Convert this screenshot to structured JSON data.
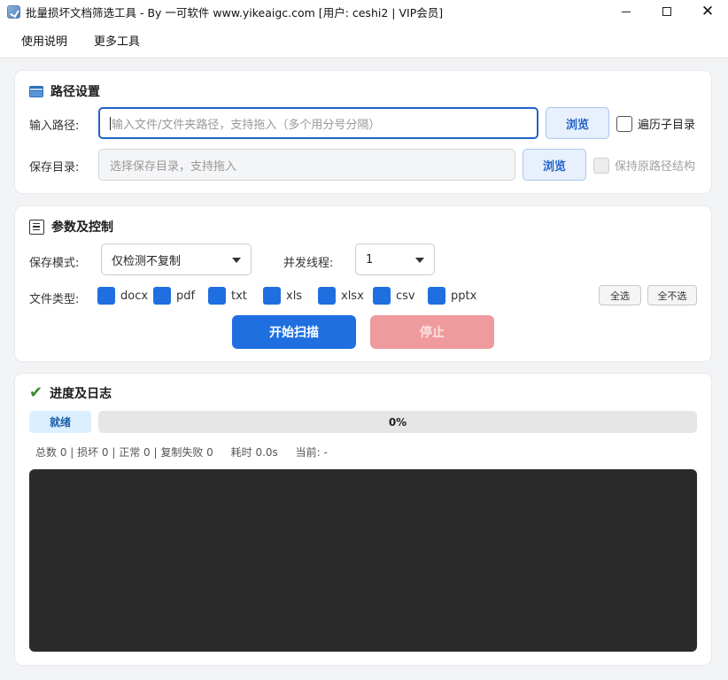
{
  "window": {
    "title": "批量损坏文档筛选工具 - By 一可软件 www.yikeaigc.com  [用户: ceshi2 | VIP会员]",
    "minimize_icon": "minimize-icon",
    "maximize_icon": "maximize-icon",
    "close_glyph": "✕"
  },
  "menu": {
    "items": [
      "使用说明",
      "更多工具"
    ]
  },
  "path_section": {
    "title": "路径设置",
    "icon": "folder-icon",
    "input_label": "输入路径:",
    "input_placeholder": "输入文件/文件夹路径，支持拖入（多个用分号分隔）",
    "input_value": "",
    "browse_label": "浏览",
    "recurse_label": "遍历子目录",
    "recurse_checked": false,
    "save_label": "保存目录:",
    "save_placeholder": "选择保存目录，支持拖入",
    "save_value": "",
    "save_browse_label": "浏览",
    "keep_structure_label": "保持原路径结构",
    "keep_structure_checked": false,
    "keep_structure_enabled": false
  },
  "params_section": {
    "title": "参数及控制",
    "icon": "list-icon",
    "mode_label": "保存模式:",
    "mode_value": "仅检测不复制",
    "threads_label": "并发线程:",
    "threads_value": "1",
    "filetype_label": "文件类型:",
    "file_types": [
      {
        "name": "docx",
        "checked": true
      },
      {
        "name": "pdf",
        "checked": true
      },
      {
        "name": "txt",
        "checked": true
      },
      {
        "name": "xls",
        "checked": true
      },
      {
        "name": "xlsx",
        "checked": true
      },
      {
        "name": "csv",
        "checked": true
      },
      {
        "name": "pptx",
        "checked": true
      }
    ],
    "select_all_label": "全选",
    "select_none_label": "全不选",
    "start_label": "开始扫描",
    "stop_label": "停止"
  },
  "progress_section": {
    "title": "进度及日志",
    "icon": "check-icon",
    "status": "就绪",
    "progress": 0,
    "progress_text": "0%",
    "stats": {
      "counts": "总数 0 | 损坏 0 | 正常 0 | 复制失败 0",
      "elapsed": "耗时 0.0s",
      "current": "当前: -"
    },
    "log": ""
  },
  "colors": {
    "accent": "#1f6fe0",
    "stop": "#ef9b9e",
    "log_bg": "#2b2b2b"
  }
}
